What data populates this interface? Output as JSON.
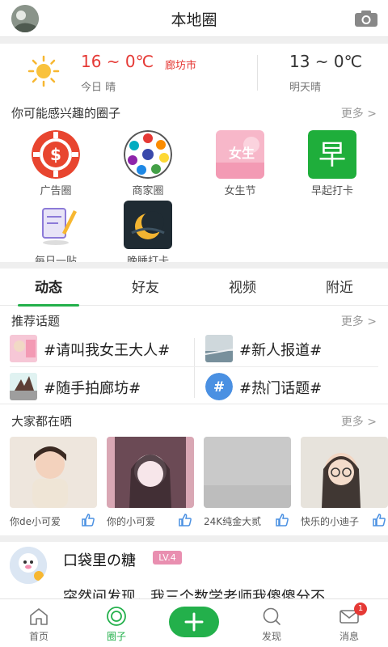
{
  "header": {
    "title": "本地圈"
  },
  "weather": {
    "today_temp": "16 ~ 0℃",
    "city": "廊坊市",
    "today_label": "今日 晴",
    "tomorrow_temp": "13 ~ 0℃",
    "tomorrow_label": "明天晴"
  },
  "interests": {
    "label": "你可能感兴趣的圈子",
    "more": "更多 >",
    "items": [
      {
        "name": "广告圈"
      },
      {
        "name": "商家圈"
      },
      {
        "name": "女生节"
      },
      {
        "name": "早起打卡"
      },
      {
        "name": "每日一贴"
      },
      {
        "name": "晚睡打卡"
      }
    ]
  },
  "tabs": [
    {
      "label": "动态"
    },
    {
      "label": "好友"
    },
    {
      "label": "视频"
    },
    {
      "label": "附近"
    }
  ],
  "topics": {
    "label": "推荐话题",
    "more": "更多 >",
    "items": [
      {
        "title": "#请叫我女王大人#"
      },
      {
        "title": "#新人报道#"
      },
      {
        "title": "#随手拍廊坊#"
      },
      {
        "title": "#热门话题#"
      }
    ]
  },
  "photos": {
    "label": "大家都在晒",
    "more": "更多 >",
    "items": [
      {
        "caption": "你de小可爱"
      },
      {
        "caption": "你的小可爱"
      },
      {
        "caption": "24K纯金大贰"
      },
      {
        "caption": "快乐的小迪子"
      }
    ]
  },
  "post": {
    "author": "口袋里の糖",
    "level": "LV.4",
    "text": "突然间发现，我三个数学老师我傻傻分不"
  },
  "bottom_nav": [
    {
      "label": "首页"
    },
    {
      "label": "圈子"
    },
    {
      "label": ""
    },
    {
      "label": "发现"
    },
    {
      "label": "消息"
    }
  ],
  "message_badge": "1",
  "colors": {
    "accent": "#23b04b",
    "temp_today": "#e53935",
    "level_badge": "#e98fb0"
  }
}
